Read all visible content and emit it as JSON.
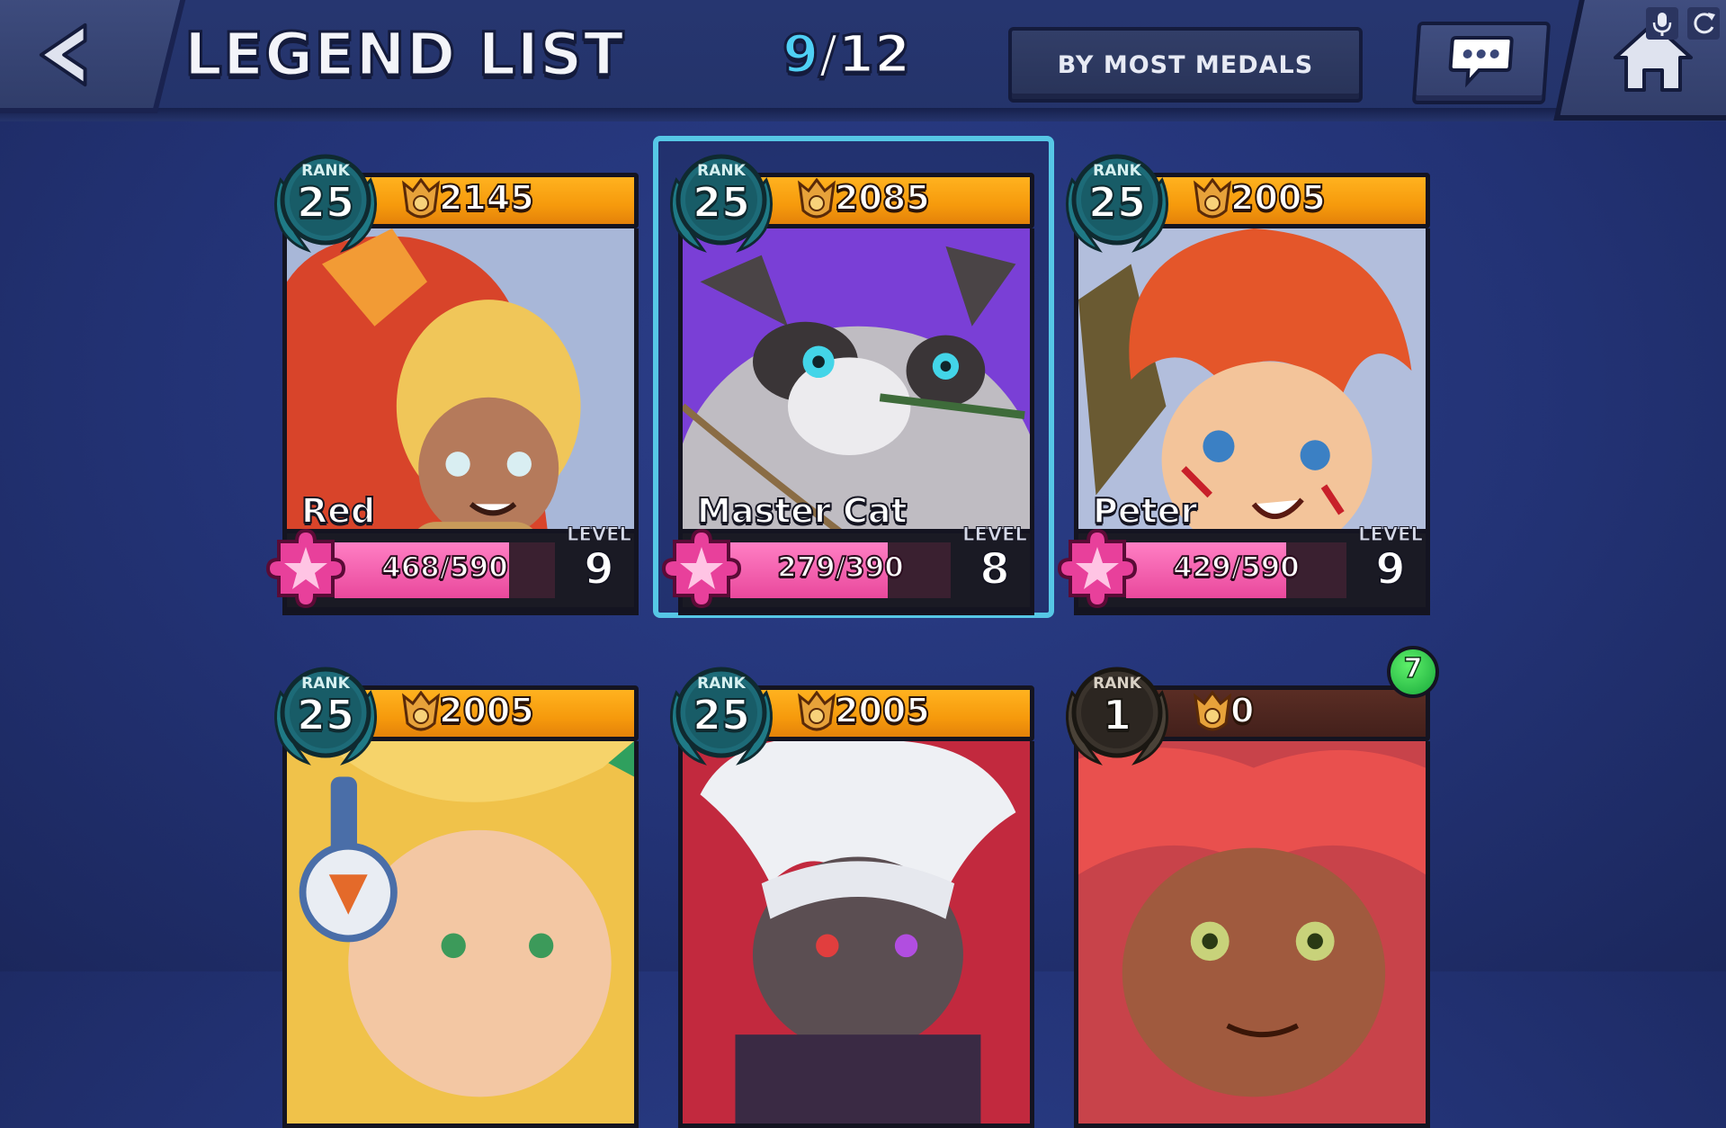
{
  "header": {
    "title": "LEGEND LIST",
    "counter_current": "9",
    "counter_total": "/12",
    "sort_label": "BY MOST MEDALS"
  },
  "icons": {
    "back": "back-arrow-icon",
    "chat": "chat-bubble-icon",
    "home": "home-icon",
    "mic": "microphone-icon",
    "refresh": "refresh-icon"
  },
  "colors": {
    "accent": "#4fd0f5",
    "medal_bar": "#f69a0c",
    "xp_bar": "#e9489c",
    "rank_badge": "#1f7a86",
    "selected_border": "#56c7e6"
  },
  "cards": [
    {
      "name": "Red",
      "rank_label": "RANK",
      "rank": "25",
      "medals": "2145",
      "xp": "468/590",
      "xp_fraction": 0.793,
      "level_label": "LEVEL",
      "level": "9",
      "selected": false
    },
    {
      "name": "Master Cat",
      "rank_label": "RANK",
      "rank": "25",
      "medals": "2085",
      "xp": "279/390",
      "xp_fraction": 0.715,
      "level_label": "LEVEL",
      "level": "8",
      "selected": true
    },
    {
      "name": "Peter",
      "rank_label": "RANK",
      "rank": "25",
      "medals": "2005",
      "xp": "429/590",
      "xp_fraction": 0.727,
      "level_label": "LEVEL",
      "level": "9",
      "selected": false
    },
    {
      "name": "",
      "rank_label": "RANK",
      "rank": "25",
      "medals": "2005",
      "selected": false
    },
    {
      "name": "",
      "rank_label": "RANK",
      "rank": "25",
      "medals": "2005",
      "selected": false
    },
    {
      "name": "",
      "rank_label": "RANK",
      "rank": "1",
      "medals": "0",
      "notification": "7",
      "selected": false
    }
  ]
}
